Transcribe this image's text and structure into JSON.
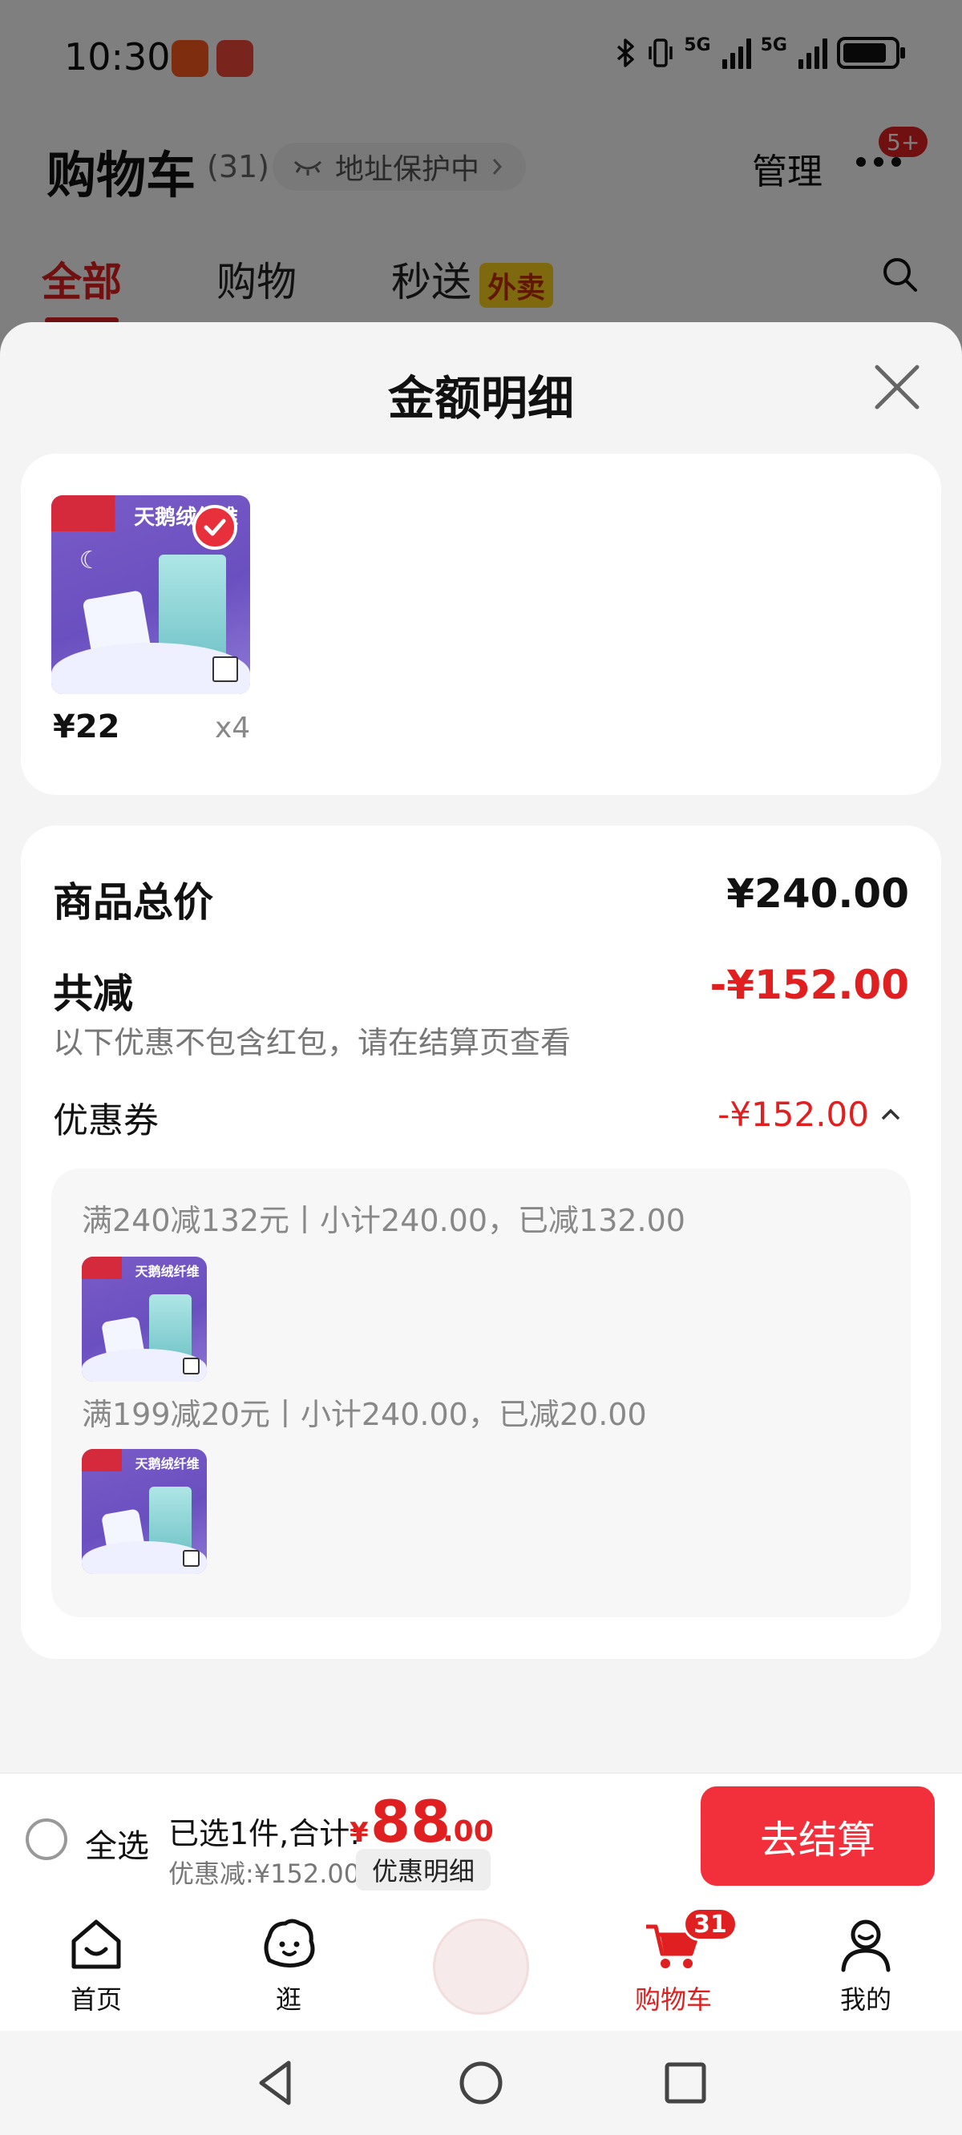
{
  "status_bar": {
    "time": "10:30",
    "sig1_label": "5G",
    "sig2_label": "5G",
    "battery_level": 0.85
  },
  "header": {
    "title": "购物车",
    "count": "(31)",
    "address_protect": "地址保护中",
    "manage": "管理",
    "notif_badge": "5+"
  },
  "tabs": [
    {
      "label": "全部",
      "active": true
    },
    {
      "label": "购物",
      "active": false
    },
    {
      "label": "秒送",
      "active": false,
      "tag": "外卖"
    }
  ],
  "sheet": {
    "title": "金额明细",
    "item": {
      "thumb_text": "天鹅绒纤维",
      "price": "¥22",
      "qty": "x4"
    },
    "total_label": "商品总价",
    "total_value": "¥240.00",
    "reduce_label": "共减",
    "reduce_value": "-¥152.00",
    "reduce_note": "以下优惠不包含红包，请在结算页查看",
    "coupon_label": "优惠券",
    "coupon_value": "-¥152.00",
    "coupons": [
      {
        "line": "满240减132元丨小计240.00，已减132.00"
      },
      {
        "line": "满199减20元丨小计240.00，已减20.00"
      }
    ]
  },
  "checkout": {
    "select_all": "全选",
    "selected_text": "已选1件,合计:",
    "currency": "¥",
    "total_int": "88",
    "total_dec": ".00",
    "discount_text": "优惠减:¥152.00",
    "detail_btn": "优惠明细",
    "checkout_btn": "去结算"
  },
  "tabbar": {
    "items": [
      {
        "label": "首页",
        "icon": "home-icon"
      },
      {
        "label": "逛",
        "icon": "explore-icon"
      },
      {
        "label": "购物车",
        "icon": "cart-icon",
        "badge": "31",
        "active": true
      },
      {
        "label": "我的",
        "icon": "profile-icon"
      }
    ]
  },
  "colors": {
    "accent": "#e02020",
    "checkout": "#f2303c",
    "tag_yellow": "#ffd21f"
  }
}
